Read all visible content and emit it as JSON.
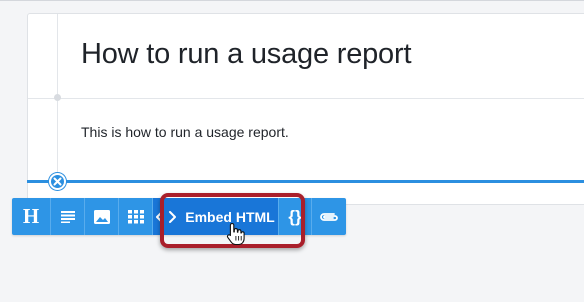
{
  "document": {
    "title": "How to run a usage report",
    "body": "This is how to run a usage report."
  },
  "toolbar": {
    "heading_label": "H",
    "embed_label": "Embed HTML",
    "embed_icon_text": "<>",
    "code_label": "{}",
    "buttons": [
      {
        "name": "heading",
        "icon": "heading-icon"
      },
      {
        "name": "paragraph",
        "icon": "paragraph-icon"
      },
      {
        "name": "image",
        "icon": "image-icon"
      },
      {
        "name": "table",
        "icon": "grid-icon"
      },
      {
        "name": "embed-html",
        "icon": "code-icon"
      },
      {
        "name": "code-block",
        "icon": "braces-icon"
      },
      {
        "name": "attachment",
        "icon": "paperclip-icon"
      }
    ]
  },
  "colors": {
    "toolbar_blue": "#2e95e6",
    "active_blue": "#1976d8",
    "highlight_red": "#a91f2b",
    "insert_line": "#2b8fe0"
  }
}
